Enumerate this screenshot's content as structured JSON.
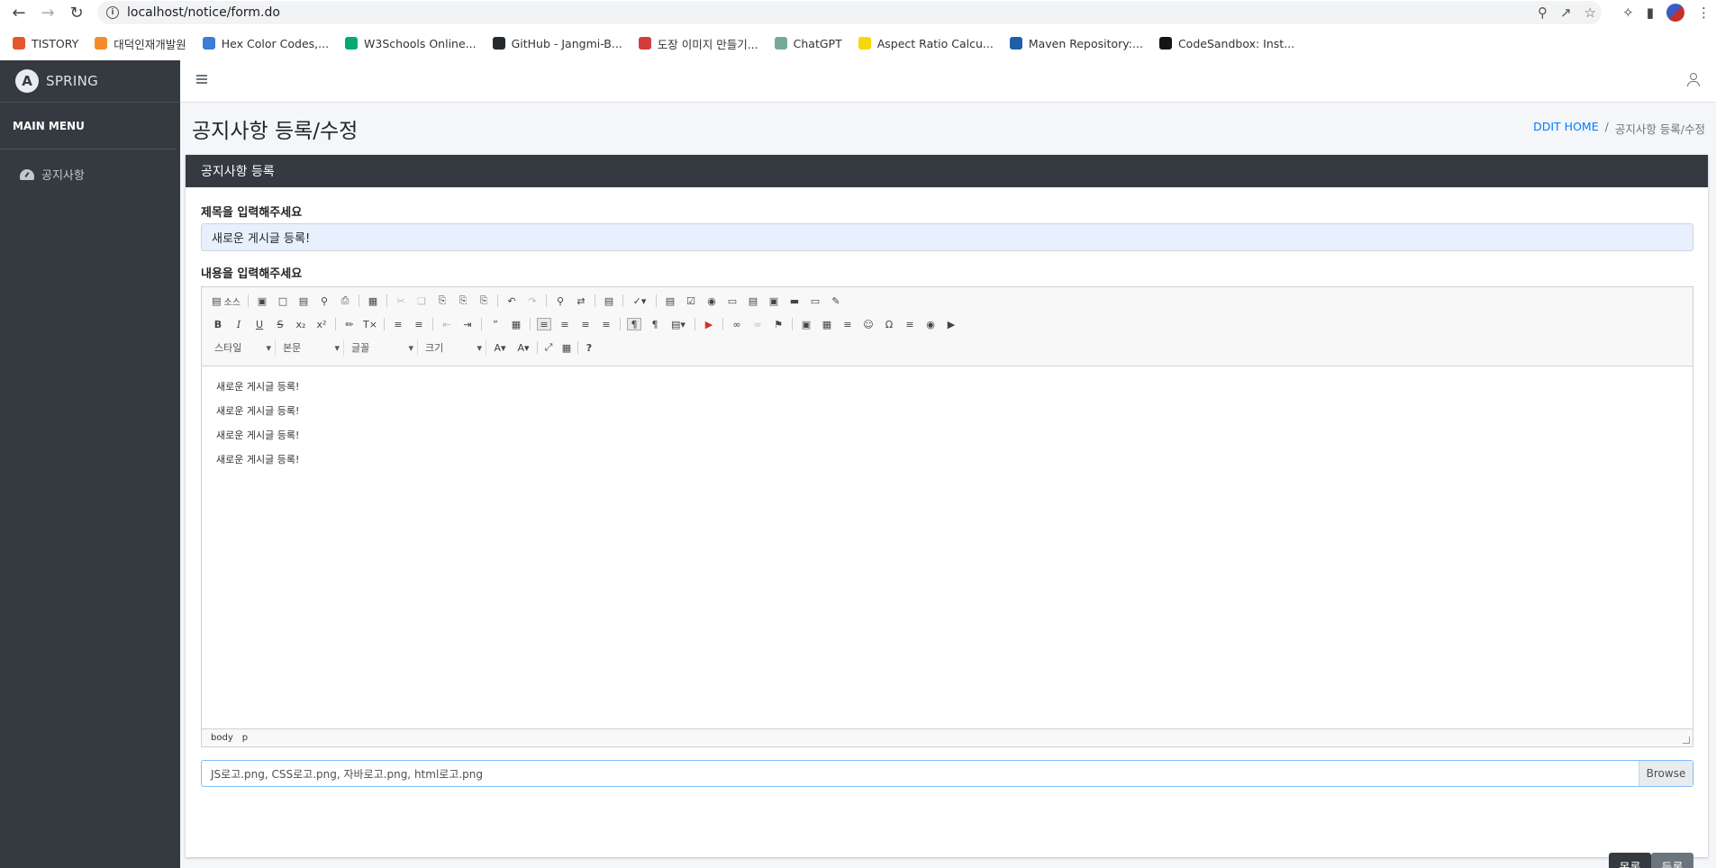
{
  "browser": {
    "url": "localhost/notice/form.do",
    "bookmarks": [
      {
        "label": "TISTORY",
        "color": "#e4572e"
      },
      {
        "label": "대덕인재개발원",
        "color": "#f28c28"
      },
      {
        "label": "Hex Color Codes,...",
        "color": "#3b7dd8"
      },
      {
        "label": "W3Schools Online...",
        "color": "#04aa6d"
      },
      {
        "label": "GitHub - Jangmi-B...",
        "color": "#24292e"
      },
      {
        "label": "도장 이미지 만들기...",
        "color": "#d33d3d"
      },
      {
        "label": "ChatGPT",
        "color": "#74aa9c"
      },
      {
        "label": "Aspect Ratio Calcu...",
        "color": "#f5d90a"
      },
      {
        "label": "Maven Repository:...",
        "color": "#1d5fa8"
      },
      {
        "label": "CodeSandbox: Inst...",
        "color": "#151515"
      }
    ]
  },
  "sidebar": {
    "brand": "SPRING",
    "brand_logo": "A",
    "menu_header": "MAIN MENU",
    "items": [
      {
        "label": "공지사항",
        "icon": "gauge-icon"
      }
    ]
  },
  "header": {
    "page_title": "공지사항 등록/수정",
    "breadcrumb": {
      "home": "DDIT HOME",
      "sep": "/",
      "current": "공지사항 등록/수정"
    }
  },
  "card": {
    "title": "공지사항 등록",
    "title_label": "제목을 입력해주세요",
    "title_value": "새로운 게시글 등록!",
    "content_label": "내용을 입력해주세요",
    "editor": {
      "lines": [
        "새로운 게시글 등록!",
        "새로운 게시글 등록!",
        "새로운 게시글 등록!",
        "새로운 게시글 등록!"
      ],
      "status": [
        "body",
        "p"
      ],
      "combos": [
        "스타일",
        "본문",
        "글꼴",
        "크기"
      ],
      "source_label": "소스"
    },
    "file_value": "JS로고.png, CSS로고.png, 자바로고.png, html로고.png",
    "browse_label": "Browse",
    "list_button": "목록",
    "submit_button": "등록"
  }
}
